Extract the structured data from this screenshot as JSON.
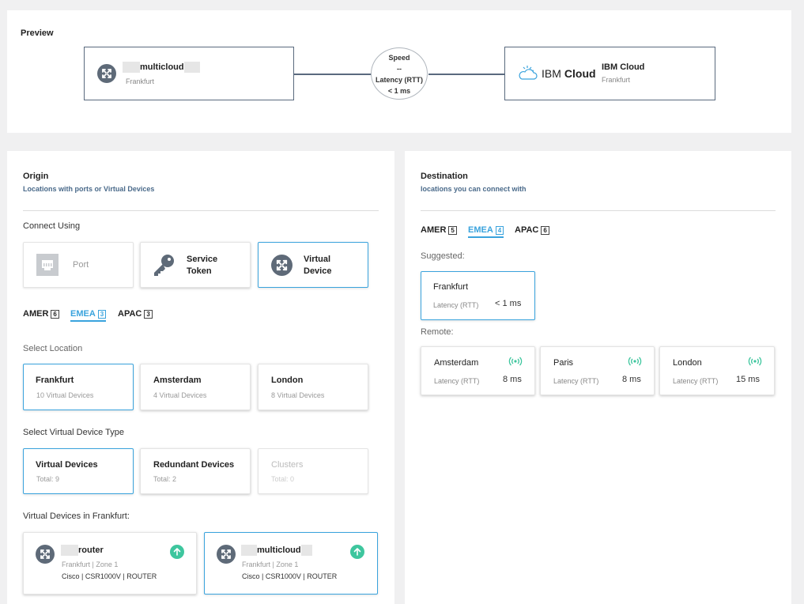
{
  "preview": {
    "title": "Preview",
    "origin": {
      "name": "multicloud",
      "location": "Frankfurt",
      "icon": "router-icon"
    },
    "link": {
      "speed_label": "Speed",
      "speed_value": "--",
      "latency_label": "Latency (RTT)",
      "latency_value": "< 1 ms"
    },
    "destination": {
      "logo_text_light": "IBM",
      "logo_text_bold": "Cloud",
      "name": "IBM Cloud",
      "location": "Frankfurt"
    }
  },
  "origin": {
    "title": "Origin",
    "subtitle": "Locations with ports or Virtual Devices",
    "connect_using_label": "Connect Using",
    "connect_options": [
      {
        "label": "Port",
        "icon": "port-icon",
        "state": "disabled"
      },
      {
        "label": "Service Token",
        "icon": "key-icon",
        "state": "default"
      },
      {
        "label": "Virtual Device",
        "icon": "router-icon",
        "state": "selected"
      }
    ],
    "region_tabs": [
      {
        "label": "AMER",
        "count": "6"
      },
      {
        "label": "EMEA",
        "count": "3",
        "active": true
      },
      {
        "label": "APAC",
        "count": "3"
      }
    ],
    "select_location_label": "Select Location",
    "locations": [
      {
        "name": "Frankfurt",
        "sub": "10 Virtual Devices",
        "selected": true
      },
      {
        "name": "Amsterdam",
        "sub": "4 Virtual Devices"
      },
      {
        "name": "London",
        "sub": "8 Virtual Devices"
      }
    ],
    "select_type_label": "Select Virtual Device Type",
    "device_types": [
      {
        "name": "Virtual Devices",
        "sub": "Total: 9",
        "selected": true
      },
      {
        "name": "Redundant Devices",
        "sub": "Total: 2"
      },
      {
        "name": "Clusters",
        "sub": "Total: 0",
        "disabled": true
      }
    ],
    "devices_label": "Virtual Devices in Frankfurt:",
    "devices": [
      {
        "name": "router",
        "location": "Frankfurt | Zone 1",
        "meta": "Cisco | CSR1000V | ROUTER",
        "status": "up"
      },
      {
        "name": "multicloud",
        "location": "Frankfurt | Zone 1",
        "meta": "Cisco | CSR1000V | ROUTER",
        "status": "up",
        "selected": true
      }
    ]
  },
  "destination": {
    "title": "Destination",
    "subtitle": "locations you can connect with",
    "region_tabs": [
      {
        "label": "AMER",
        "count": "5"
      },
      {
        "label": "EMEA",
        "count": "4",
        "active": true
      },
      {
        "label": "APAC",
        "count": "6"
      }
    ],
    "suggested_label": "Suggested:",
    "suggested": {
      "name": "Frankfurt",
      "latency_label": "Latency (RTT)",
      "latency": "< 1 ms"
    },
    "remote_label": "Remote:",
    "remote": [
      {
        "name": "Amsterdam",
        "latency_label": "Latency (RTT)",
        "latency": "8 ms"
      },
      {
        "name": "Paris",
        "latency_label": "Latency (RTT)",
        "latency": "8 ms"
      },
      {
        "name": "London",
        "latency_label": "Latency (RTT)",
        "latency": "15 ms"
      }
    ]
  },
  "colors": {
    "accent": "#3aa3dd",
    "status_up": "#3ec69e",
    "border_dark": "#5a6a7e"
  }
}
